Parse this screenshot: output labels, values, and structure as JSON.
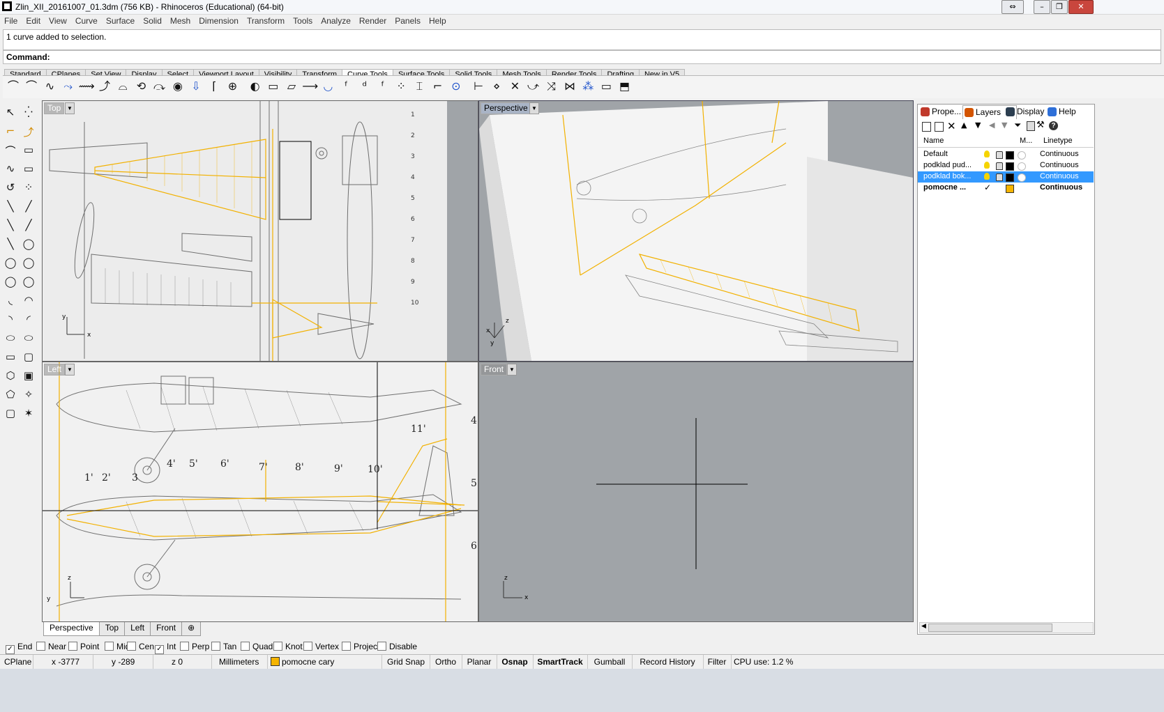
{
  "window": {
    "title": "Zlin_XII_20161007_01.3dm (756 KB) - Rhinoceros (Educational) (64-bit)"
  },
  "menu": [
    "File",
    "Edit",
    "View",
    "Curve",
    "Surface",
    "Solid",
    "Mesh",
    "Dimension",
    "Transform",
    "Tools",
    "Analyze",
    "Render",
    "Panels",
    "Help"
  ],
  "command": {
    "history": "1 curve added to selection.",
    "prompt": "Command:"
  },
  "toolbar_tabs": [
    "Standard",
    "CPlanes",
    "Set View",
    "Display",
    "Select",
    "Viewport Layout",
    "Visibility",
    "Transform",
    "Curve Tools",
    "Surface Tools",
    "Solid Tools",
    "Mesh Tools",
    "Render Tools",
    "Drafting",
    "New in V5"
  ],
  "toolbar_tab_active": "Curve Tools",
  "toolbar_icons": [
    "fillet-curves-icon",
    "chamfer-curves-icon",
    "blend-curves-icon",
    "match-curve-icon",
    "offset-curve-icon",
    "curve-from-2-views-icon",
    "arc-blend-icon",
    "adjust-seam-icon",
    "rebuild-curve-icon",
    "curve-sphere-icon",
    "pull-curve-icon",
    "fillet-corners-icon",
    "curve-boolean-icon",
    "silhouette-icon",
    "make-2d-icon",
    "planar-curves-icon",
    "extend-curve-icon",
    "convert-arcs-icon",
    "curve-fit-icon",
    "dec-icon",
    "fair-icon",
    "points-icon",
    "insert-kink-icon",
    "curve-edit-icon",
    "control-point-icon",
    "handle-bar-icon",
    "add-knot-icon",
    "remove-knot-icon",
    "close-crv-icon",
    "symmetry-icon",
    "join-icon",
    "explode-icon",
    "layer-icon",
    "split-icon"
  ],
  "viewports": {
    "top": {
      "label": "Top"
    },
    "perspective": {
      "label": "Perspective"
    },
    "left": {
      "label": "Left"
    },
    "front": {
      "label": "Front"
    }
  },
  "drawing_labels": {
    "left_numbers": [
      "1'",
      "2'",
      "3",
      "4'",
      "5'",
      "6'",
      "7'",
      "8'",
      "9'",
      "10'",
      "11'"
    ],
    "side_marks": [
      "4",
      "5",
      "6"
    ],
    "top_marks": [
      "1",
      "2",
      "3",
      "4",
      "5",
      "6",
      "7",
      "8",
      "9",
      "10"
    ],
    "axis_x": "x",
    "axis_y": "y",
    "axis_z": "z"
  },
  "view_tabs": [
    "Perspective",
    "Top",
    "Left",
    "Front"
  ],
  "view_tab_active": "Perspective",
  "panel": {
    "tabs": [
      "Prope...",
      "Layers",
      "Display",
      "Help"
    ],
    "active_tab": "Layers",
    "columns": {
      "name": "Name",
      "material": "M...",
      "linetype": "Linetype"
    },
    "layers": [
      {
        "name": "Default",
        "linetype": "Continuous",
        "color": "#000000",
        "selected": false,
        "current": false
      },
      {
        "name": "podklad pud...",
        "linetype": "Continuous",
        "color": "#000000",
        "selected": false,
        "current": false
      },
      {
        "name": "podklad bok...",
        "linetype": "Continuous",
        "color": "#000000",
        "selected": true,
        "current": false
      },
      {
        "name": "pomocne ...",
        "linetype": "Continuous",
        "color": "#f5b400",
        "selected": false,
        "current": true,
        "check": "✓"
      }
    ]
  },
  "osnaps": [
    {
      "label": "End",
      "checked": true
    },
    {
      "label": "Near",
      "checked": false
    },
    {
      "label": "Point",
      "checked": false
    },
    {
      "label": "Mid",
      "checked": false
    },
    {
      "label": "Cen",
      "checked": false
    },
    {
      "label": "Int",
      "checked": true
    },
    {
      "label": "Perp",
      "checked": false
    },
    {
      "label": "Tan",
      "checked": false
    },
    {
      "label": "Quad",
      "checked": false
    },
    {
      "label": "Knot",
      "checked": false
    },
    {
      "label": "Vertex",
      "checked": false
    },
    {
      "label": "Project",
      "checked": false
    },
    {
      "label": "Disable",
      "checked": false
    }
  ],
  "status": {
    "cplane": "CPlane",
    "x": "x -3777",
    "y": "y -289",
    "z": "z 0",
    "units": "Millimeters",
    "layer": "pomocne cary",
    "layer_color": "#f5b400",
    "toggles": [
      "Grid Snap",
      "Ortho",
      "Planar",
      "Osnap",
      "SmartTrack",
      "Gumball",
      "Record History",
      "Filter"
    ],
    "toggles_bold": [
      "Osnap",
      "SmartTrack"
    ],
    "cpu": "CPU use: 1.2 %"
  },
  "colors": {
    "accent_curve": "#f2b100",
    "viewport_bg": "#a0a4a8",
    "selection": "#3399ff"
  }
}
